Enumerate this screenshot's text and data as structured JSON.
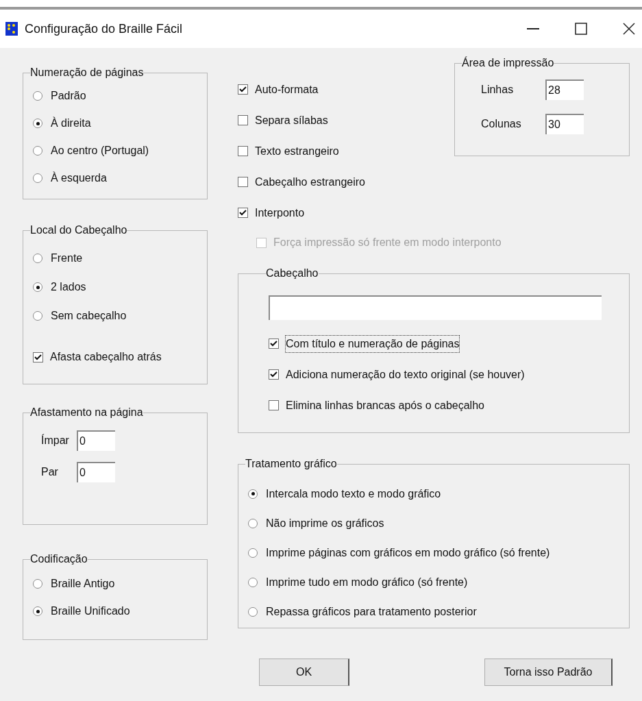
{
  "window": {
    "title": "Configuração do Braille Fácil"
  },
  "page_numbering": {
    "label": "Numeração de páginas",
    "options": [
      {
        "label": "Padrão",
        "selected": false
      },
      {
        "label": "À direita",
        "selected": true
      },
      {
        "label": "Ao centro (Portugal)",
        "selected": false
      },
      {
        "label": "À esquerda",
        "selected": false
      }
    ]
  },
  "header_location": {
    "label": "Local do Cabeçalho",
    "options": [
      {
        "label": "Frente",
        "selected": false
      },
      {
        "label": "2 lados",
        "selected": true
      },
      {
        "label": "Sem cabeçalho",
        "selected": false
      }
    ],
    "push_back": {
      "label": "Afasta cabeçalho atrás",
      "checked": true
    }
  },
  "page_margin": {
    "label": "Afastamento na  página",
    "fields": [
      {
        "label": "Ímpar",
        "value": "0"
      },
      {
        "label": "Par",
        "value": "0"
      }
    ]
  },
  "encoding": {
    "label": "Codificação",
    "options": [
      {
        "label": "Braille Antigo",
        "selected": false
      },
      {
        "label": "Braille Unificado",
        "selected": true
      }
    ]
  },
  "options": [
    {
      "label": "Auto-formata",
      "checked": true
    },
    {
      "label": "Separa sílabas",
      "checked": false
    },
    {
      "label": "Texto estrangeiro",
      "checked": false
    },
    {
      "label": "Cabeçalho estrangeiro",
      "checked": false
    },
    {
      "label": "Interponto",
      "checked": true,
      "children": [
        {
          "label": "Força impressão só frente em modo interponto",
          "checked": false,
          "disabled": true
        }
      ]
    }
  ],
  "print_area": {
    "label": "Área de impressão",
    "fields": [
      {
        "label": "Linhas",
        "value": "28"
      },
      {
        "label": "Colunas",
        "value": "30"
      }
    ]
  },
  "header": {
    "label": "Cabeçalho",
    "options": [
      {
        "label": "Com título e numeração de páginas",
        "checked": true,
        "focused": true
      },
      {
        "label": "Adiciona numeração do texto original (se houver)",
        "checked": true,
        "focused": false
      },
      {
        "label": "Elimina linhas brancas após o cabeçalho",
        "checked": false,
        "focused": false
      }
    ]
  },
  "graphics": {
    "label": "Tratamento gráfico",
    "options": [
      {
        "label": "Intercala modo texto e modo gráfico",
        "selected": true
      },
      {
        "label": "Não imprime os gráficos",
        "selected": false
      },
      {
        "label": "Imprime páginas com gráficos em modo gráfico (só frente)",
        "selected": false
      },
      {
        "label": "Imprime tudo em modo gráfico (só frente)",
        "selected": false
      },
      {
        "label": "Repassa gráficos para tratamento posterior",
        "selected": false
      }
    ]
  },
  "buttons": [
    {
      "label": "OK"
    },
    {
      "label": "Torna isso Padrão"
    }
  ]
}
